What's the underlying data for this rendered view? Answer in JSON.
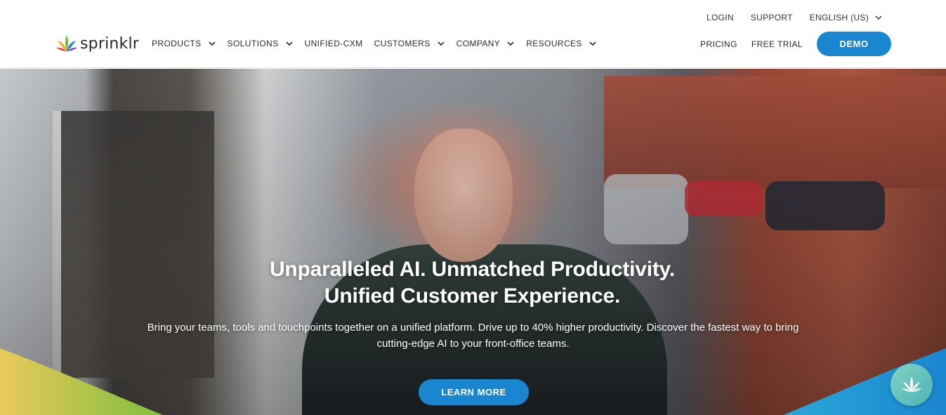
{
  "header": {
    "brand": "sprinklr",
    "utility": {
      "login": "LOGIN",
      "support": "SUPPORT",
      "language": "ENGLISH (US)"
    },
    "nav": {
      "products": "PRODUCTS",
      "solutions": "SOLUTIONS",
      "unified_cxm": "UNIFIED-CXM",
      "customers": "CUSTOMERS",
      "company": "COMPANY",
      "resources": "RESOURCES"
    },
    "right": {
      "pricing": "PRICING",
      "free_trial": "FREE TRIAL",
      "demo": "DEMO"
    }
  },
  "hero": {
    "title_line1": "Unparalleled AI. Unmatched Productivity.",
    "title_line2": "Unified Customer Experience.",
    "subtitle": "Bring your teams, tools and touchpoints together on a unified platform. Drive up to 40% higher productivity. Discover the fastest way to bring cutting-edge AI to your front-office teams.",
    "cta": "LEARN MORE"
  },
  "icons": {
    "logo": "sprinklr-logo-icon",
    "chevron": "chevron-down-icon",
    "chat": "chat-widget-icon"
  },
  "colors": {
    "accent": "#1a86d0",
    "chat": "#5fc1bd"
  }
}
